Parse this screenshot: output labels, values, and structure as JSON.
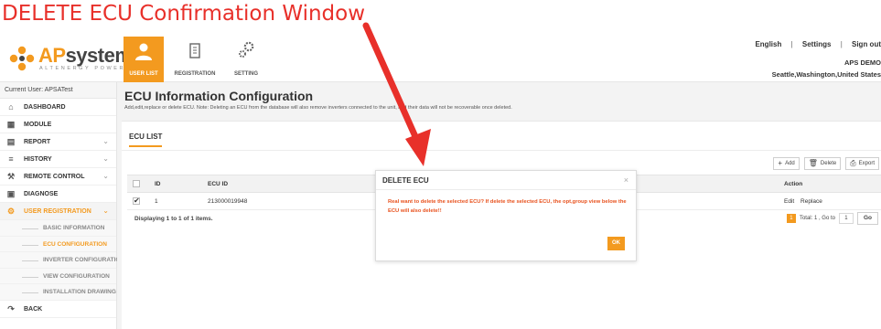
{
  "annotation": {
    "title": "DELETE ECU Confirmation Window",
    "arrow_color": "#e8302a"
  },
  "brand": {
    "name_orange": "AP",
    "name_rest": "systems",
    "tagline": "ALTENERGY POWER",
    "accent": "#f39a1f"
  },
  "topnav": [
    {
      "label": "USER LIST",
      "icon": "users-icon",
      "active": true
    },
    {
      "label": "REGISTRATION",
      "icon": "building-icon",
      "active": false
    },
    {
      "label": "SETTING",
      "icon": "gears-icon",
      "active": false
    }
  ],
  "header": {
    "language": "English",
    "separator": "|",
    "settings": "Settings",
    "signout": "Sign out",
    "account": "APS DEMO",
    "location": "Seattle,Washington,United States"
  },
  "sidebar": {
    "current_user": "Current User: APSATest",
    "items": [
      {
        "label": "DASHBOARD",
        "icon": "home-icon"
      },
      {
        "label": "MODULE",
        "icon": "grid-icon"
      },
      {
        "label": "REPORT",
        "icon": "report-icon",
        "chevron": "⌄"
      },
      {
        "label": "HISTORY",
        "icon": "history-icon",
        "chevron": "⌄"
      },
      {
        "label": "REMOTE CONTROL",
        "icon": "wrench-icon",
        "chevron": "⌄"
      },
      {
        "label": "DIAGNOSE",
        "icon": "diagnose-icon"
      },
      {
        "label": "USER REGISTRATION",
        "icon": "cogs-icon",
        "chevron": "⌄"
      }
    ],
    "subitems": [
      {
        "label": "BASIC INFORMATION"
      },
      {
        "label": "ECU CONFIGURATION"
      },
      {
        "label": "INVERTER CONFIGURATION"
      },
      {
        "label": "VIEW CONFIGURATION"
      },
      {
        "label": "INSTALLATION DRAWING"
      }
    ],
    "back": {
      "label": "BACK",
      "icon": "back-icon"
    }
  },
  "page": {
    "title": "ECU Information Configuration",
    "description": "Add,edit,replace or delete ECU. Note: Deleting an ECU from the database will also remove inverters connected to the unit, and their data will not be recoverable once deleted."
  },
  "card": {
    "tab": "ECU LIST",
    "toolbar": {
      "add": "Add",
      "delete": "Delete",
      "export": "Export"
    },
    "table": {
      "headers": {
        "id": "ID",
        "ecu_id": "ECU ID",
        "action": "Action"
      },
      "rows": [
        {
          "id": "1",
          "ecu_id": "213000019948",
          "checked": "✔",
          "edit": "Edit",
          "replace": "Replace"
        }
      ]
    },
    "pager": {
      "summary": "Displaying 1 to 1 of 1 items.",
      "page": "1",
      "total": "Total: 1 , Go to",
      "goto_value": "1",
      "go": "Go"
    }
  },
  "dialog": {
    "title": "DELETE ECU",
    "close": "×",
    "message": "Real want to delete the selected ECU? If delete the selected ECU, the opt,group view below the ECU will also delete!!",
    "ok": "OK"
  }
}
